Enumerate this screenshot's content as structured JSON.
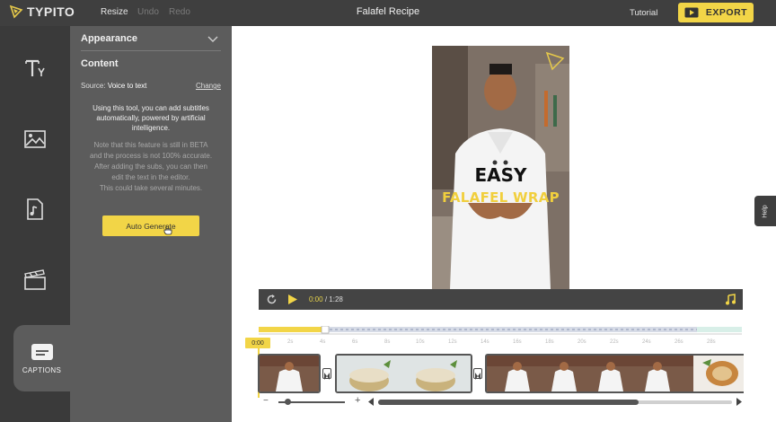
{
  "app": {
    "brand": "TYPITO",
    "title": "Falafel Recipe"
  },
  "toolbar": {
    "resize": "Resize",
    "undo": "Undo",
    "redo": "Redo",
    "tutorial": "Tutorial",
    "export": "EXPORT"
  },
  "sidebar": {
    "captions_label": "CAPTIONS"
  },
  "panel": {
    "appearance": "Appearance",
    "content": "Content",
    "source_label": "Source:",
    "source_value": "Voice to text",
    "change": "Change",
    "description": "Using this tool, you can add subtitles automatically, powered by artificial intelligence.",
    "note_lines": [
      "Note that this feature is still in BETA",
      "and the process is not 100% accurate.",
      "After adding the subs, you can then",
      "edit the text in the editor.",
      "This could take several minutes."
    ],
    "auto_generate": "Auto Generate"
  },
  "video": {
    "text_line1": "EASY",
    "text_line2": "FALAFEL WRAP"
  },
  "player": {
    "current_time": "0:00",
    "separator": "/",
    "total_time": "1:28"
  },
  "help": {
    "label": "Help"
  },
  "timeline": {
    "playhead_time": "0:00",
    "ticks": [
      "2s",
      "4s",
      "6s",
      "8s",
      "10s",
      "12s",
      "14s",
      "16s",
      "18s",
      "20s",
      "22s",
      "24s",
      "26s",
      "28s"
    ],
    "zoom_minus": "−",
    "zoom_plus": "+"
  },
  "colors": {
    "accent": "#f2d547",
    "topbar": "#3f3f3f",
    "panel": "#5c5c5c",
    "iconbar": "#3a3a3a"
  }
}
